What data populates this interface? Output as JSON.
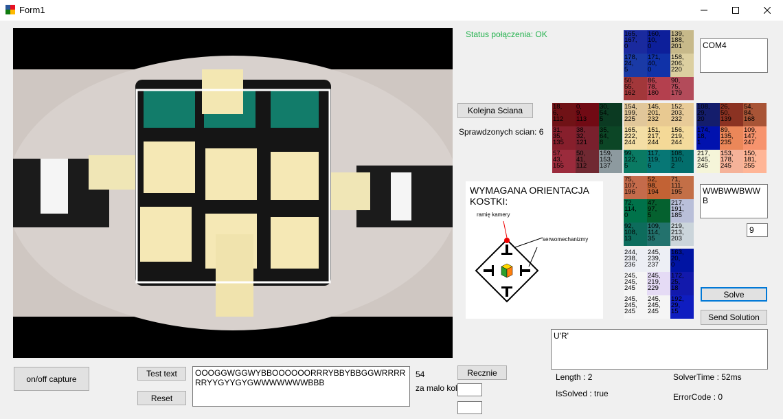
{
  "window": {
    "title": "Form1"
  },
  "status": {
    "text": "Status połączenia: OK",
    "color": "#22b14c"
  },
  "buttons": {
    "next_face": "Kolejna Sciana",
    "onoff_capture": "on/off capture",
    "test_text": "Test text",
    "reset": "Reset",
    "manual": "Recznie",
    "solve": "Solve",
    "send_solution": "Send Solution"
  },
  "labels": {
    "checked_faces": "Sprawdzonych scian: 6",
    "count": "54",
    "too_few": "za malo kolorow",
    "length": "Length : 2",
    "is_solved": "IsSolved : true",
    "solver_time": "SolverTime : 52ms",
    "error_code": "ErrorCode : 0"
  },
  "inputs": {
    "com_port": "COM4",
    "face_text": "WWBWWBWWB",
    "number": "9",
    "solution": "U'R'",
    "cube_string": "OOOGGWGGWYBBOOOOOORRRYBBYBBGGWRRRRRRYYGYYGYGWWWWWWWBBB",
    "small1": "",
    "small2": ""
  },
  "orientation": {
    "title": "WYMAGANA ORIENTACJA KOSTKI:",
    "camera_arm": "ramię kamery",
    "servos": "serwomechanizmy"
  },
  "faces": {
    "up": [
      {
        "t": "165,\n167,\n0",
        "c": "#1a2a9e"
      },
      {
        "t": "160,\n10,\n0",
        "c": "#0d1f9a"
      },
      {
        "t": "139,\n188,\n201",
        "c": "#c7b98a"
      },
      {
        "t": "178,\n24,\n5",
        "c": "#1a3aa6"
      },
      {
        "t": "171,\n40,\n0",
        "c": "#1032a8"
      },
      {
        "t": "158,\n206,\n220",
        "c": "#dccfa0"
      },
      {
        "t": "50,\n55,\n162",
        "c": "#a2373a"
      },
      {
        "t": "86,\n78,\n180",
        "c": "#b4404e"
      },
      {
        "t": "90,\n75,\n179",
        "c": "#b34b5a"
      }
    ],
    "left": [
      {
        "t": "18,\n6,\n112",
        "c": "#701216"
      },
      {
        "t": "0,\n9,\n113",
        "c": "#710a14"
      },
      {
        "t": "30,\n54,\n5",
        "c": "#0b3a22"
      },
      {
        "t": "31,\n35,\n135",
        "c": "#871f2c"
      },
      {
        "t": "38,\n32,\n121",
        "c": "#79202d"
      },
      {
        "t": "35,\n64,\n8",
        "c": "#0c4626"
      },
      {
        "t": "57,\n43,\n155",
        "c": "#9b2b3c"
      },
      {
        "t": "50,\n41,\n112",
        "c": "#702932"
      },
      {
        "t": "159,\n153,\n137",
        "c": "#8d9a9f"
      }
    ],
    "front": [
      {
        "t": "154,\n199,\n225",
        "c": "#e1c79a"
      },
      {
        "t": "145,\n201,\n232",
        "c": "#e8c991"
      },
      {
        "t": "152,\n203,\n232",
        "c": "#e8cb98"
      },
      {
        "t": "165,\n222,\n244",
        "c": "#f4dea5"
      },
      {
        "t": "151,\n217,\n244",
        "c": "#f4d997"
      },
      {
        "t": "156,\n219,\n244",
        "c": "#f4db9c"
      },
      {
        "t": "99,\n122,\n5",
        "c": "#0a7a63"
      },
      {
        "t": "117,\n119,\n6",
        "c": "#077775"
      },
      {
        "t": "108,\n110,\n2",
        "c": "#036e6c"
      }
    ],
    "right": [
      {
        "t": "108,\n29,\n20",
        "c": "#141d6c"
      },
      {
        "t": "26,\n50,\n139",
        "c": "#8b3222"
      },
      {
        "t": "54,\n84,\n168",
        "c": "#a85436"
      },
      {
        "t": "174,\n18,\n1",
        "c": "#0112ae"
      },
      {
        "t": "89,\n135,\n235",
        "c": "#eb8759"
      },
      {
        "t": "109,\n147,\n247",
        "c": "#f7936d"
      },
      {
        "t": "217,\n245,\n245",
        "c": "#f5f5d9"
      },
      {
        "t": "153,\n178,\n245",
        "c": "#f5b299"
      },
      {
        "t": "150,\n181,\n255",
        "c": "#ffb596"
      }
    ],
    "down": [
      {
        "t": "75,\n107,\n196",
        "c": "#c46b4b"
      },
      {
        "t": "52,\n98,\n194",
        "c": "#c26234"
      },
      {
        "t": "71,\n111,\n195",
        "c": "#c36f47"
      },
      {
        "t": "72,\n114,\n0",
        "c": "#00724a"
      },
      {
        "t": "47,\n97,\n5",
        "c": "#05612f"
      },
      {
        "t": "217,\n191,\n185",
        "c": "#b9bfd9"
      },
      {
        "t": "92,\n108,\n13",
        "c": "#0d6c5c"
      },
      {
        "t": "109,\n114,\n35",
        "c": "#23726d"
      },
      {
        "t": "219,\n213,\n203",
        "c": "#cbd5db"
      }
    ],
    "back": [
      {
        "t": "244,\n238,\n236",
        "c": "#eceef4"
      },
      {
        "t": "245,\n239,\n237",
        "c": "#edeff5"
      },
      {
        "t": "163,\n20,\n0",
        "c": "#0014a3"
      },
      {
        "t": "245,\n245,\n245",
        "c": "#f5f5f5"
      },
      {
        "t": "245,\n219,\n229",
        "c": "#e5dbf5"
      },
      {
        "t": "172,\n25,\n18",
        "c": "#1219ac"
      },
      {
        "t": "245,\n245,\n245",
        "c": "#f5f5f5"
      },
      {
        "t": "245,\n245,\n245",
        "c": "#f5f5f5"
      },
      {
        "t": "192,\n29,\n15",
        "c": "#0f1dc0"
      }
    ]
  }
}
